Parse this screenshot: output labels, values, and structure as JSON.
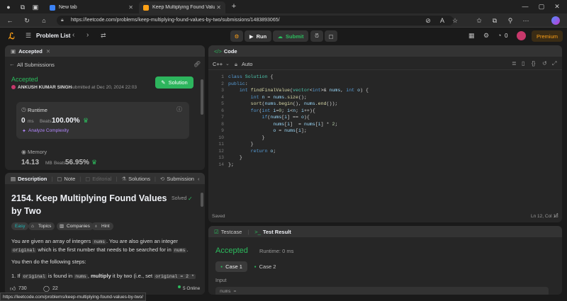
{
  "browser": {
    "tabs": [
      {
        "label": "New tab"
      },
      {
        "label": "Keep Multiplying Found Values to"
      }
    ],
    "url": "https://leetcode.com/problems/keep-multiplying-found-values-by-two/submissions/1483893065/",
    "status_url": "https://leetcode.com/problems/keep-multiplying-found-values-by-two/"
  },
  "nav": {
    "problem_list": "Problem List",
    "run": "Run",
    "submit": "Submit",
    "streak": "0",
    "premium": "Premium"
  },
  "left_top": {
    "tab_label": "Accepted",
    "back_label": "All Submissions",
    "status": "Accepted",
    "author": "ANKUSH KUMAR SINGH",
    "submitted": "submitted at Dec 20, 2024 22:03",
    "solution_btn": "Solution",
    "runtime_label": "Runtime",
    "runtime_value": "0",
    "runtime_unit": "ms",
    "beats_label": "Beats",
    "runtime_beats": "100.00%",
    "analyze": "Analyze Complexity",
    "memory_label": "Memory",
    "memory_value": "14.13",
    "memory_unit": "MB",
    "memory_beats": "56.95%"
  },
  "left_bottom": {
    "tabs": [
      "Description",
      "Note",
      "Editorial",
      "Solutions",
      "Submission"
    ],
    "title_line1": "2154. Keep Multiplying Found Values",
    "title_line2": "by Two",
    "solved": "Solved",
    "tags": [
      "Easy",
      "Topics",
      "Companies",
      "Hint"
    ],
    "p1a": "You are given an array of integers",
    "p1code": "nums",
    "p1b": ". You are also given an integer",
    "p2code": "original",
    "p2b": "which is the first number that needs to be searched for in",
    "p2code2": "nums",
    "p3": "You then do the following steps:",
    "step_num": "1. If",
    "step_code": "original",
    "step_mid": "is found in",
    "step_code2": "nums",
    "step_bold": "multiply",
    "step_end": "it by two (i.e., set",
    "step_code3": "original = 2 *",
    "likes": "730",
    "comments": "22",
    "online": "5 Online"
  },
  "code_panel": {
    "title": "Code",
    "language": "C++",
    "auto": "Auto",
    "saved": "Saved",
    "cursor": "Ln 12, Col 18",
    "lines": [
      "class Solution {",
      "public:",
      "    int findFinalValue(vector<int>& nums, int o) {",
      "        int n = nums.size();",
      "        sort(nums.begin(), nums.end());",
      "        for(int i=0; i<n; i++){",
      "            if(nums[i] == o){",
      "                nums[i]  = nums[i] * 2;",
      "                o = nums[i];",
      "            }",
      "        }",
      "        return o;",
      "    }",
      "};"
    ]
  },
  "result_panel": {
    "tab_testcase": "Testcase",
    "tab_result": "Test Result",
    "status": "Accepted",
    "runtime": "Runtime: 0 ms",
    "case1": "Case 1",
    "case2": "Case 2",
    "input_label": "Input",
    "input_value": "nums ="
  },
  "colors": {
    "accent_green": "#2cbb5d",
    "solution_btn": "#2db55d",
    "premium": "#ffa116",
    "code_bg": "#1e1e1e"
  }
}
